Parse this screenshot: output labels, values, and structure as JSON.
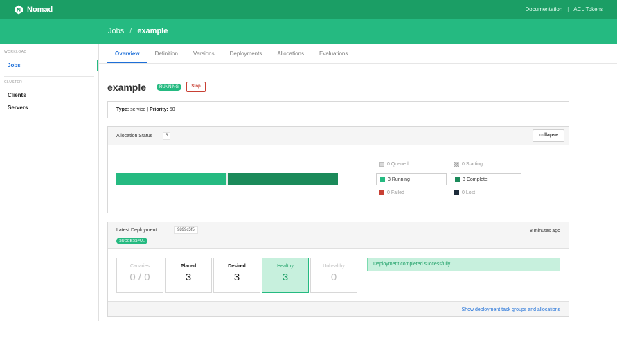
{
  "app": {
    "name": "Nomad"
  },
  "topnav": {
    "documentation": "Documentation",
    "separator": "|",
    "acl_tokens": "ACL Tokens"
  },
  "breadcrumb": {
    "parent": "Jobs",
    "separator": "/",
    "current": "example"
  },
  "sidebar": {
    "sections": [
      {
        "label": "WORKLOAD",
        "items": [
          {
            "label": "Jobs",
            "active": true
          }
        ]
      },
      {
        "label": "CLUSTER",
        "items": [
          {
            "label": "Clients"
          },
          {
            "label": "Servers"
          }
        ]
      }
    ]
  },
  "tabs": [
    {
      "label": "Overview",
      "active": true
    },
    {
      "label": "Definition"
    },
    {
      "label": "Versions"
    },
    {
      "label": "Deployments"
    },
    {
      "label": "Allocations"
    },
    {
      "label": "Evaluations"
    }
  ],
  "job": {
    "name": "example",
    "status": "RUNNING",
    "stop_label": "Stop",
    "type_label": "Type:",
    "type_value": "service",
    "divider": "|",
    "priority_label": "Priority:",
    "priority_value": "50"
  },
  "allocation_status": {
    "title": "Allocation Status",
    "count": "6",
    "collapse_label": "collapse",
    "bar": {
      "running": 3,
      "complete": 3,
      "total": 6
    },
    "legend": {
      "queued": "0 Queued",
      "starting": "0 Starting",
      "running": "3 Running",
      "complete": "3 Complete",
      "failed": "0 Failed",
      "lost": "0 Lost"
    },
    "colors": {
      "queued": "#d9d9d9",
      "starting": "#bdbdbd",
      "running": "#25ba81",
      "complete": "#1b8a5a",
      "failed": "#c84034",
      "lost": "#1d2b3a"
    }
  },
  "deployment": {
    "title": "Latest Deployment",
    "id": "9899c5f5",
    "status": "SUCCESSFUL",
    "time": "8 minutes ago",
    "metrics": {
      "canaries": {
        "label": "Canaries",
        "value": "0 / 0"
      },
      "placed": {
        "label": "Placed",
        "value": "3"
      },
      "desired": {
        "label": "Desired",
        "value": "3"
      },
      "healthy": {
        "label": "Healthy",
        "value": "3"
      },
      "unhealthy": {
        "label": "Unhealthy",
        "value": "0"
      }
    },
    "notice": "Deployment completed successfully",
    "footer_link": "Show deployment task groups and allocations"
  }
}
